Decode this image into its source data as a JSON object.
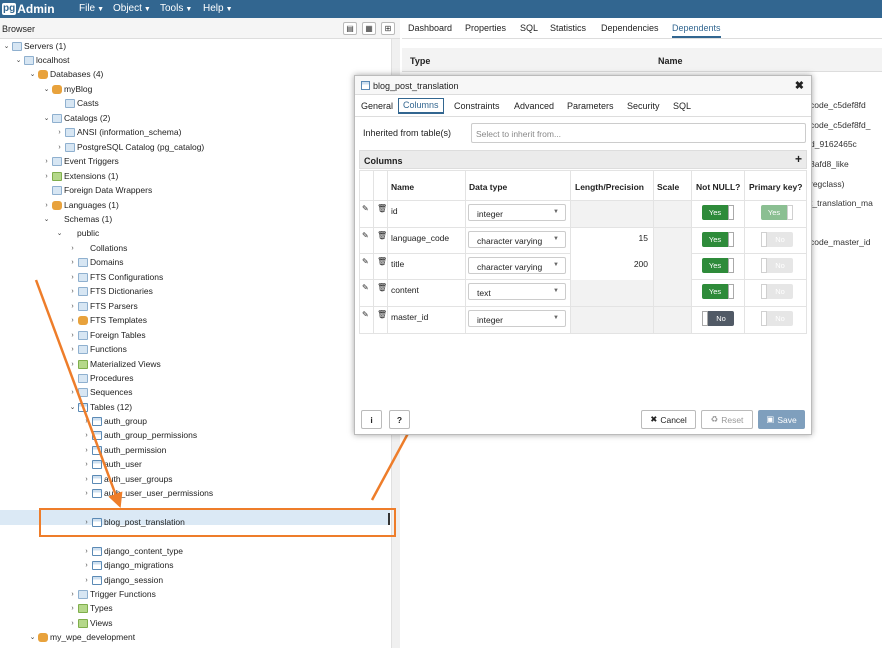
{
  "app": {
    "logo_prefix": "pg",
    "logo_suffix": "Admin"
  },
  "menu": [
    {
      "label": "File"
    },
    {
      "label": "Object"
    },
    {
      "label": "Tools"
    },
    {
      "label": "Help"
    }
  ],
  "browser": {
    "title": "Browser"
  },
  "panel_tabs": [
    "Dashboard",
    "Properties",
    "SQL",
    "Statistics",
    "Dependencies",
    "Dependents"
  ],
  "tree": [
    {
      "label": "Servers (1)",
      "icon": "servers-icon"
    },
    {
      "label": "localhost",
      "icon": "server-icon"
    },
    {
      "label": "Databases (4)",
      "icon": "databases-icon"
    },
    {
      "label": "myBlog",
      "icon": "database-icon"
    },
    {
      "label": "Casts",
      "icon": "casts-icon"
    },
    {
      "label": "Catalogs (2)",
      "icon": "catalogs-icon"
    },
    {
      "label": "ANSI (information_schema)",
      "icon": "catalog-icon"
    },
    {
      "label": "PostgreSQL Catalog (pg_catalog)",
      "icon": "catalog-icon"
    },
    {
      "label": "Event Triggers",
      "icon": "event-trigger-icon"
    },
    {
      "label": "Extensions (1)",
      "icon": "extension-icon"
    },
    {
      "label": "Foreign Data Wrappers",
      "icon": "fdw-icon"
    },
    {
      "label": "Languages (1)",
      "icon": "language-icon"
    },
    {
      "label": "Schemas (1)",
      "icon": "schemas-icon"
    },
    {
      "label": "public",
      "icon": "schema-icon"
    },
    {
      "label": "Collations",
      "icon": "collation-icon"
    },
    {
      "label": "Domains",
      "icon": "domain-icon"
    },
    {
      "label": "FTS Configurations",
      "icon": "fts-config-icon"
    },
    {
      "label": "FTS Dictionaries",
      "icon": "fts-dict-icon"
    },
    {
      "label": "FTS Parsers",
      "icon": "fts-parser-icon"
    },
    {
      "label": "FTS Templates",
      "icon": "fts-template-icon"
    },
    {
      "label": "Foreign Tables",
      "icon": "foreign-table-icon"
    },
    {
      "label": "Functions",
      "icon": "function-icon"
    },
    {
      "label": "Materialized Views",
      "icon": "mview-icon"
    },
    {
      "label": "Procedures",
      "icon": "procedure-icon"
    },
    {
      "label": "Sequences",
      "icon": "sequence-icon"
    },
    {
      "label": "Tables (12)",
      "icon": "tables-icon"
    },
    {
      "label": "auth_group",
      "icon": "table-icon"
    },
    {
      "label": "auth_group_permissions",
      "icon": "table-icon"
    },
    {
      "label": "auth_permission",
      "icon": "table-icon"
    },
    {
      "label": "auth_user",
      "icon": "table-icon"
    },
    {
      "label": "auth_user_groups",
      "icon": "table-icon"
    },
    {
      "label": "auth_user_user_permissions",
      "icon": "table-icon"
    },
    {
      "label": "blog_post_translation",
      "icon": "table-icon"
    },
    {
      "label": "django_content_type",
      "icon": "table-icon"
    },
    {
      "label": "django_migrations",
      "icon": "table-icon"
    },
    {
      "label": "django_session",
      "icon": "table-icon"
    },
    {
      "label": "Trigger Functions",
      "icon": "trigger-function-icon"
    },
    {
      "label": "Types",
      "icon": "type-icon"
    },
    {
      "label": "Views",
      "icon": "view-icon"
    },
    {
      "label": "my_wpe_development",
      "icon": "database-icon"
    }
  ],
  "dependents": {
    "headers": {
      "type": "Type",
      "name": "Name"
    },
    "rows": [
      "code_c5def8fd",
      "code_c5def8fd_",
      "d_9162465c",
      "8afd8_like",
      "regclass)",
      "t_translation_ma",
      "code_master_id"
    ]
  },
  "dialog": {
    "title": "blog_post_translation",
    "tabs": [
      "General",
      "Columns",
      "Constraints",
      "Advanced",
      "Parameters",
      "Security",
      "SQL"
    ],
    "active_tab": "Columns",
    "inherit_label": "Inherited from table(s)",
    "inherit_placeholder": "Select to inherit from...",
    "columns_title": "Columns",
    "grid_headers": {
      "name": "Name",
      "type": "Data type",
      "length": "Length/Precision",
      "scale": "Scale",
      "notnull": "Not NULL?",
      "pk": "Primary key?"
    },
    "columns": [
      {
        "name": "id",
        "type": "integer",
        "length": "",
        "scale": "",
        "not_null": "Yes",
        "pk": "Yes"
      },
      {
        "name": "language_code",
        "type": "character varying",
        "length": "15",
        "scale": "",
        "not_null": "Yes",
        "pk": "No"
      },
      {
        "name": "title",
        "type": "character varying",
        "length": "200",
        "scale": "",
        "not_null": "Yes",
        "pk": "No"
      },
      {
        "name": "content",
        "type": "text",
        "length": "",
        "scale": "",
        "not_null": "Yes",
        "pk": "No"
      },
      {
        "name": "master_id",
        "type": "integer",
        "length": "",
        "scale": "",
        "not_null": "No",
        "pk": "No"
      }
    ],
    "buttons": {
      "info": "i",
      "help": "?",
      "cancel": "Cancel",
      "reset": "Reset",
      "save": "Save"
    }
  },
  "colors": {
    "header": "#326690",
    "accent": "#326690",
    "yes": "#2e8b3a",
    "no": "#d2d2d2",
    "highlight": "#ee7d2a"
  }
}
